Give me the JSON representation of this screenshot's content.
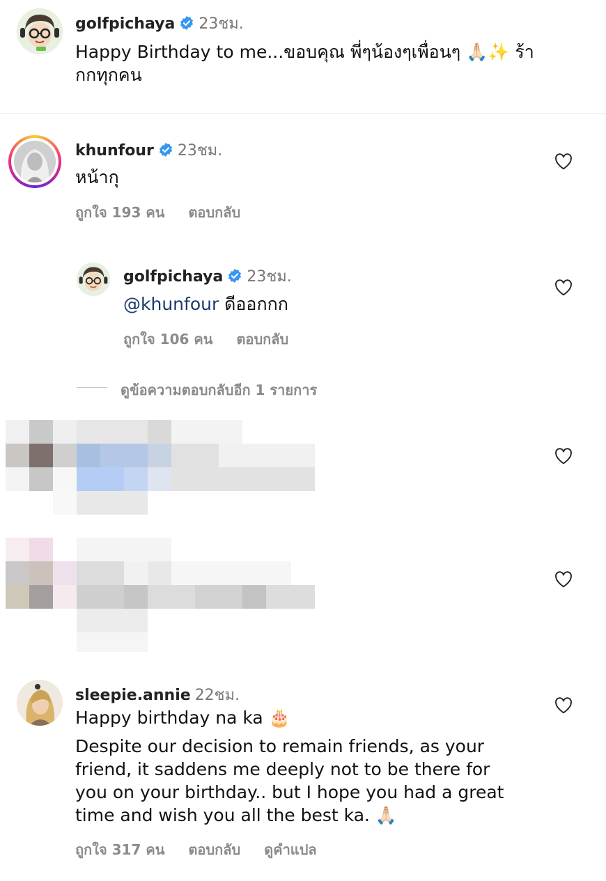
{
  "post": {
    "username": "golfpichaya",
    "time": "23ชม.",
    "caption_line1": "Happy Birthday to me...ขอบคุณ พี่ๆน้องๆเพื่อนๆ 🙏🏻✨ ร้า",
    "caption_line2": "กกทุกคน"
  },
  "comments": [
    {
      "username": "khunfour",
      "time": "23ชม.",
      "text": "หน้ากุ",
      "likes": "ถูกใจ 193 คน",
      "reply_label": "ตอบกลับ"
    },
    {
      "username": "sleepie.annie",
      "time": "22ชม.",
      "text_line1": "Happy birthday na ka 🎂",
      "text_line2": "Despite our decision to remain friends, as your",
      "text_line3": "friend, it saddens me deeply not to be there for",
      "text_line4": "you on your birthday.. but I hope you had a great",
      "text_line5": "time and wish you all the best ka. 🙏🏻",
      "likes": "ถูกใจ 317 คน",
      "reply_label": "ตอบกลับ",
      "translate_label": "ดูคำแปล"
    }
  ],
  "reply": {
    "username": "golfpichaya",
    "time": "23ชม.",
    "mention": "@khunfour",
    "text": " ดีออกกก",
    "likes": "ถูกใจ 106 คน",
    "reply_label": "ตอบกลับ"
  },
  "view_replies": "ดูข้อความตอบกลับอีก 1 รายการ",
  "colors": {
    "verified": "#3897f0",
    "mention": "#1c3a6b",
    "meta": "#8a8a8a"
  }
}
